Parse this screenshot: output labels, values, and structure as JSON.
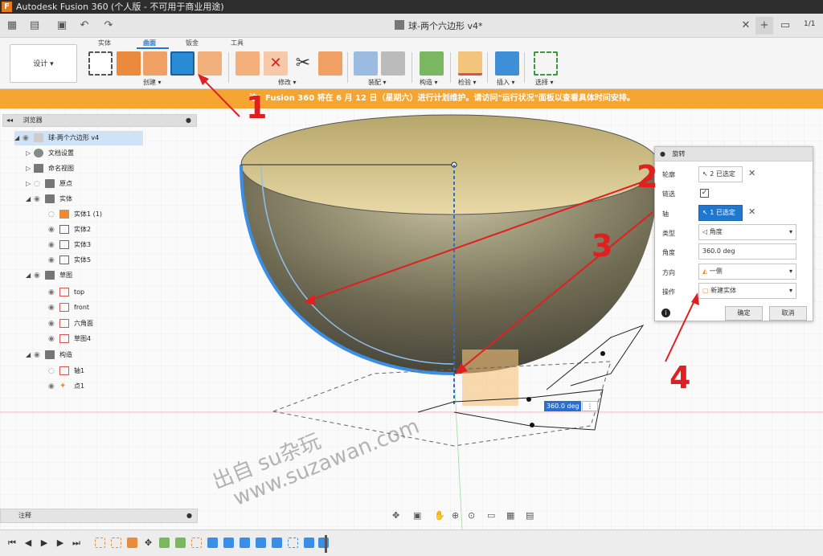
{
  "titlebar": {
    "title": "Autodesk Fusion 360 (个人版 - 不可用于商业用途)",
    "logo": "F"
  },
  "appbar": {
    "doc_title": "球-两个六边形 v4*",
    "page_indicator": "1/1"
  },
  "toolbar": {
    "workspace_label": "设计 ▾",
    "tabs": [
      "实体",
      "曲面",
      "钣金",
      "工具"
    ],
    "active_tab": "曲面",
    "groups": [
      "创建 ▾",
      "修改 ▾",
      "装配 ▾",
      "构造 ▾",
      "检验 ▾",
      "插入 ▾",
      "选择 ▾"
    ]
  },
  "banner": {
    "text": "注：Fusion 360 将在 6 月 12 日（星期六）进行计划维护。请访问\"运行状况\"面板以查看具体时间安排。"
  },
  "browser": {
    "header": "浏览器",
    "nodes": [
      {
        "label": "球-两个六边形 v4"
      },
      {
        "label": "文档设置"
      },
      {
        "label": "命名视图"
      },
      {
        "label": "原点"
      },
      {
        "label": "实体"
      },
      {
        "label": "实体1 (1)"
      },
      {
        "label": "实体2"
      },
      {
        "label": "实体3"
      },
      {
        "label": "实体5"
      },
      {
        "label": "草图"
      },
      {
        "label": "top"
      },
      {
        "label": "front"
      },
      {
        "label": "六角面"
      },
      {
        "label": "草图4"
      },
      {
        "label": "构造"
      },
      {
        "label": "轴1"
      },
      {
        "label": "点1"
      }
    ]
  },
  "revolve_panel": {
    "title": "旋转",
    "profile_label": "轮廓",
    "profile_value": "2 已选定",
    "chain_label": "链选",
    "chain_checked": true,
    "axis_label": "轴",
    "axis_value": "1 已选定",
    "type_label": "类型",
    "type_value": "角度",
    "angle_label": "角度",
    "angle_value": "360.0 deg",
    "direction_label": "方向",
    "direction_value": "一侧",
    "operation_label": "操作",
    "operation_value": "新建实体",
    "ok_label": "确定",
    "cancel_label": "取消",
    "info_icon": "info-icon"
  },
  "viewport": {
    "angle_input": "360.0 deg"
  },
  "notes": {
    "label": "注释"
  },
  "annotations": [
    "1",
    "2",
    "3",
    "4"
  ],
  "watermark": {
    "line1": "出自 su杂玩",
    "line2": "www.suzawan.com"
  },
  "colors": {
    "accent": "#1f77d0",
    "banner": "#f6a531",
    "annotation": "#e02020"
  }
}
